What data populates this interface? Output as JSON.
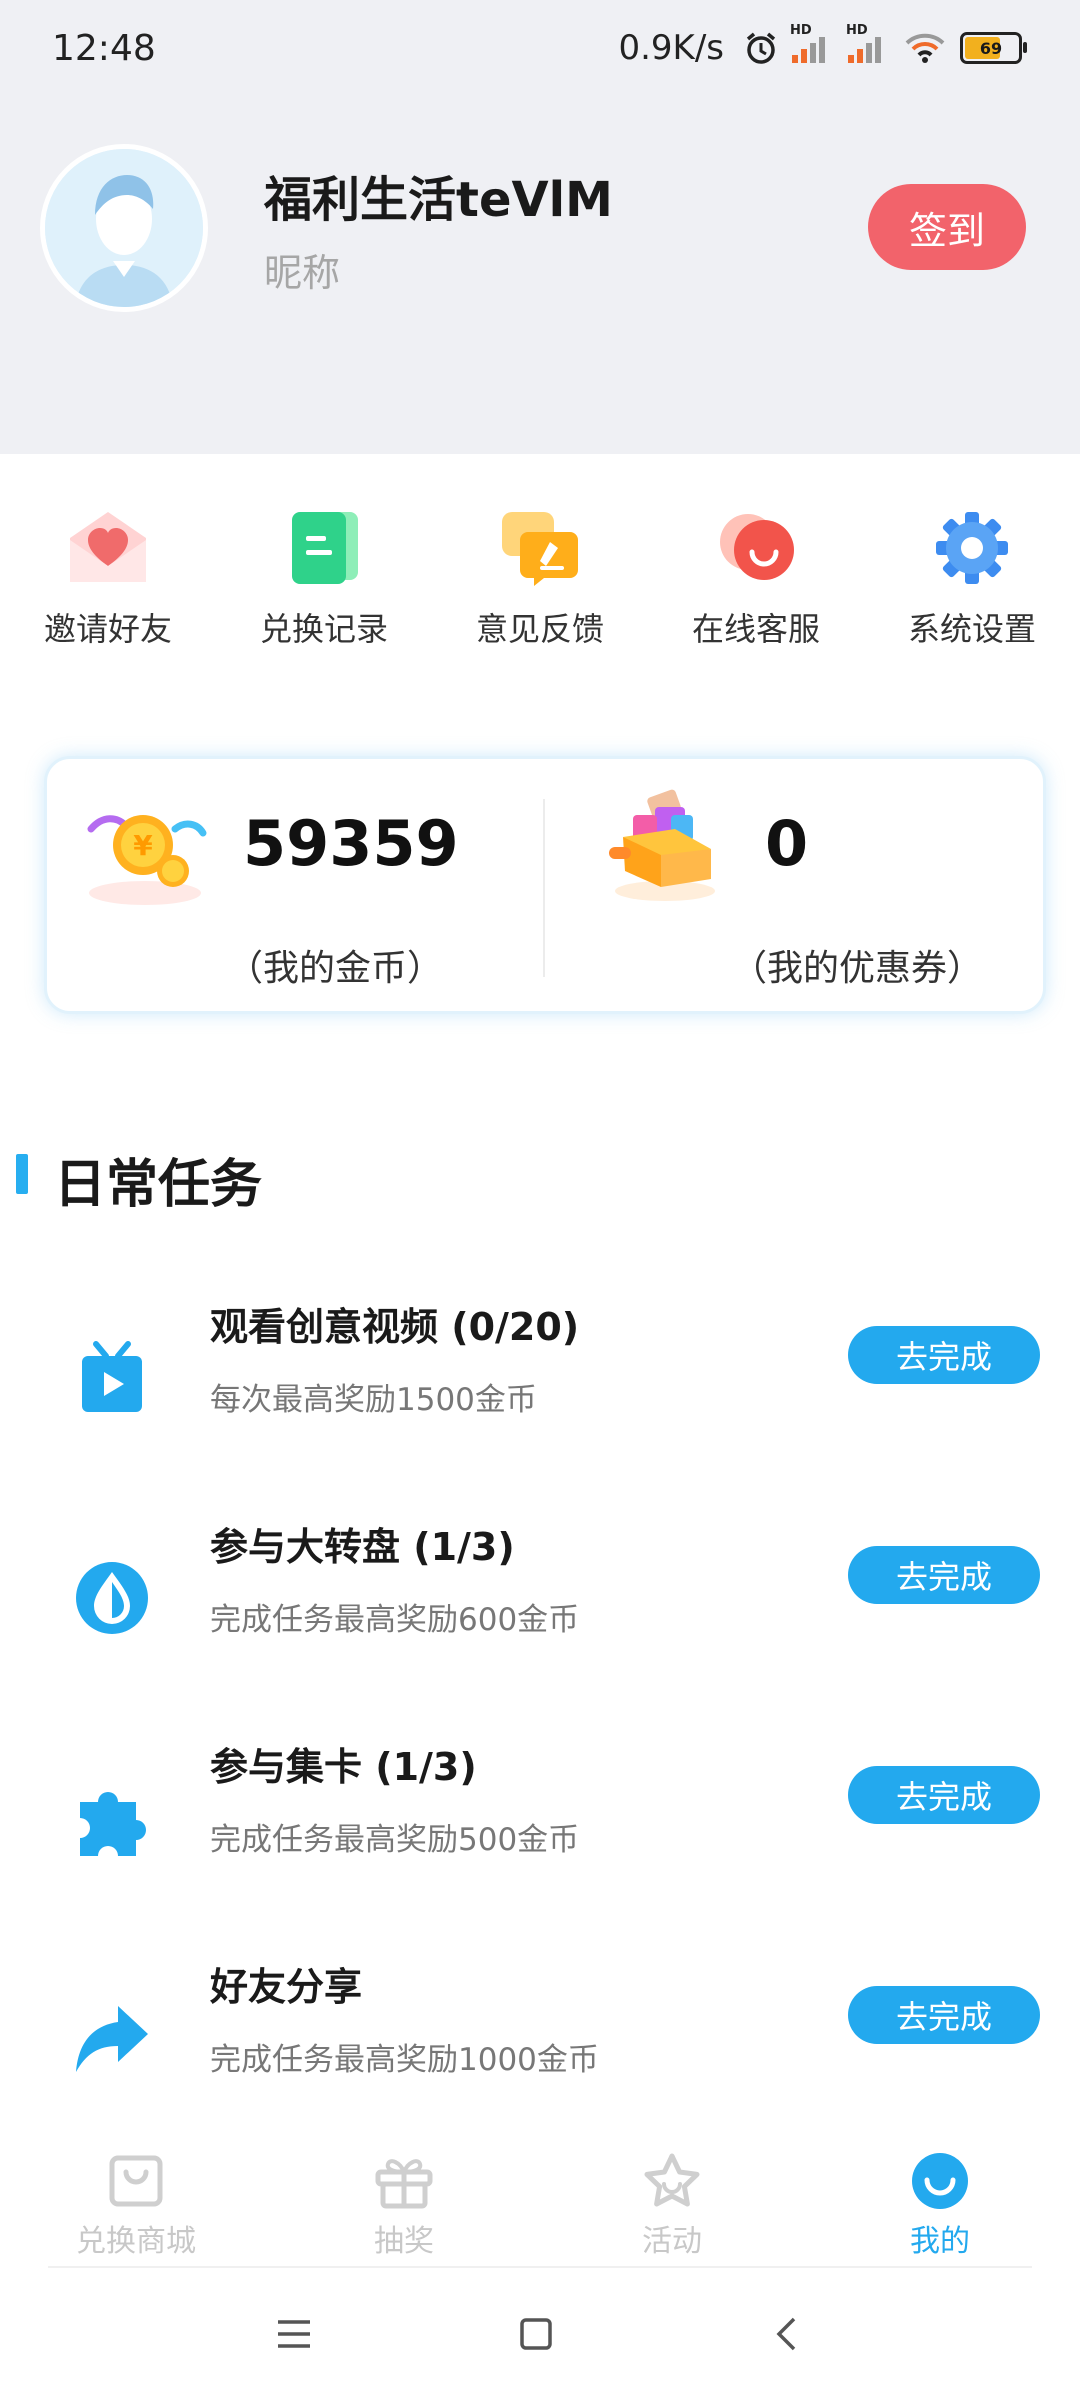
{
  "status_bar": {
    "time": "12:48",
    "net_speed": "0.9K/s",
    "battery_level": "69",
    "icons": [
      "alarm-icon",
      "hd-signal-icon",
      "hd-signal-icon",
      "wifi-icon",
      "battery-icon"
    ]
  },
  "profile": {
    "nickname": "福利生活teVlM",
    "nickname_sub": "昵称",
    "signin_label": "签到",
    "signin_color": "#f2636b"
  },
  "entries": [
    {
      "label": "邀请好友",
      "icon": "invite-envelope-icon"
    },
    {
      "label": "兑换记录",
      "icon": "record-document-icon"
    },
    {
      "label": "意见反馈",
      "icon": "feedback-chat-icon"
    },
    {
      "label": "在线客服",
      "icon": "customer-service-chat-icon"
    },
    {
      "label": "系统设置",
      "icon": "gear-icon"
    }
  ],
  "wallet": {
    "coins_value": "59359",
    "coins_label": "（我的金币）",
    "coupons_value": "0",
    "coupons_label": "（我的优惠券）"
  },
  "tasks": {
    "section_title": "日常任务",
    "button_label": "去完成",
    "accent_color": "#23a9ee",
    "items": [
      {
        "title": "观看创意视频 (0/20)",
        "desc": "每次最高奖励1500金币",
        "icon": "tv-play-icon"
      },
      {
        "title": "参与大转盘 (1/3)",
        "desc": "完成任务最高奖励600金币",
        "icon": "drop-circle-icon"
      },
      {
        "title": "参与集卡 (1/3)",
        "desc": "完成任务最高奖励500金币",
        "icon": "puzzle-icon"
      },
      {
        "title": "好友分享",
        "desc": "完成任务最高奖励1000金币",
        "icon": "share-arrow-icon"
      }
    ]
  },
  "bottom_nav": [
    {
      "label": "兑换商城",
      "icon": "shopping-bag-icon",
      "active": false
    },
    {
      "label": "抽奖",
      "icon": "gift-icon",
      "active": false
    },
    {
      "label": "活动",
      "icon": "star-icon",
      "active": false
    },
    {
      "label": "我的",
      "icon": "smile-icon",
      "active": true
    }
  ],
  "system_nav": [
    "menu-icon",
    "home-square-icon",
    "back-chevron-icon"
  ]
}
